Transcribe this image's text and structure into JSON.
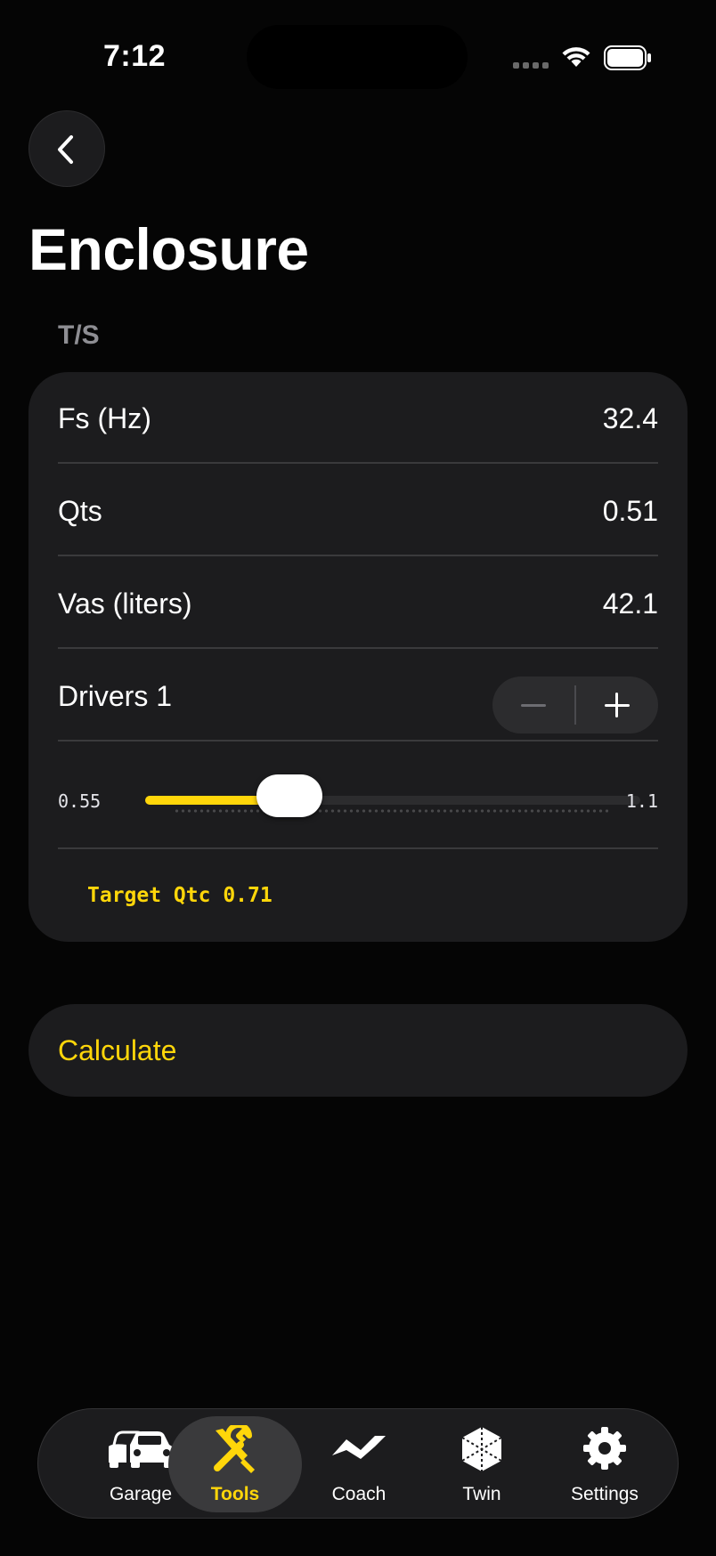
{
  "status_bar": {
    "time": "7:12"
  },
  "header": {
    "title": "Enclosure"
  },
  "section": {
    "label": "T/S"
  },
  "params": {
    "fs": {
      "label": "Fs (Hz)",
      "value": "32.4"
    },
    "qts": {
      "label": "Qts",
      "value": "0.51"
    },
    "vas": {
      "label": "Vas (liters)",
      "value": "42.1"
    },
    "drivers": {
      "label": "Drivers 1",
      "count": 1
    }
  },
  "slider": {
    "min_label": "0.55",
    "max_label": "1.1",
    "min": 0.55,
    "max": 1.1,
    "value": 0.71
  },
  "target": {
    "label": "Target Qtc 0.71"
  },
  "actions": {
    "calculate": "Calculate"
  },
  "tab_bar": {
    "active": "tools",
    "items": [
      {
        "id": "garage",
        "label": "Garage",
        "icon": "car-icon"
      },
      {
        "id": "tools",
        "label": "Tools",
        "icon": "wrench-screwdriver-icon"
      },
      {
        "id": "coach",
        "label": "Coach",
        "icon": "waveform-icon"
      },
      {
        "id": "twin",
        "label": "Twin",
        "icon": "cube-icon"
      },
      {
        "id": "settings",
        "label": "Settings",
        "icon": "gear-icon"
      }
    ]
  },
  "colors": {
    "accent": "#ffd60a",
    "background": "#050505",
    "card": "#1c1c1e",
    "separator": "#3a3a3c"
  }
}
